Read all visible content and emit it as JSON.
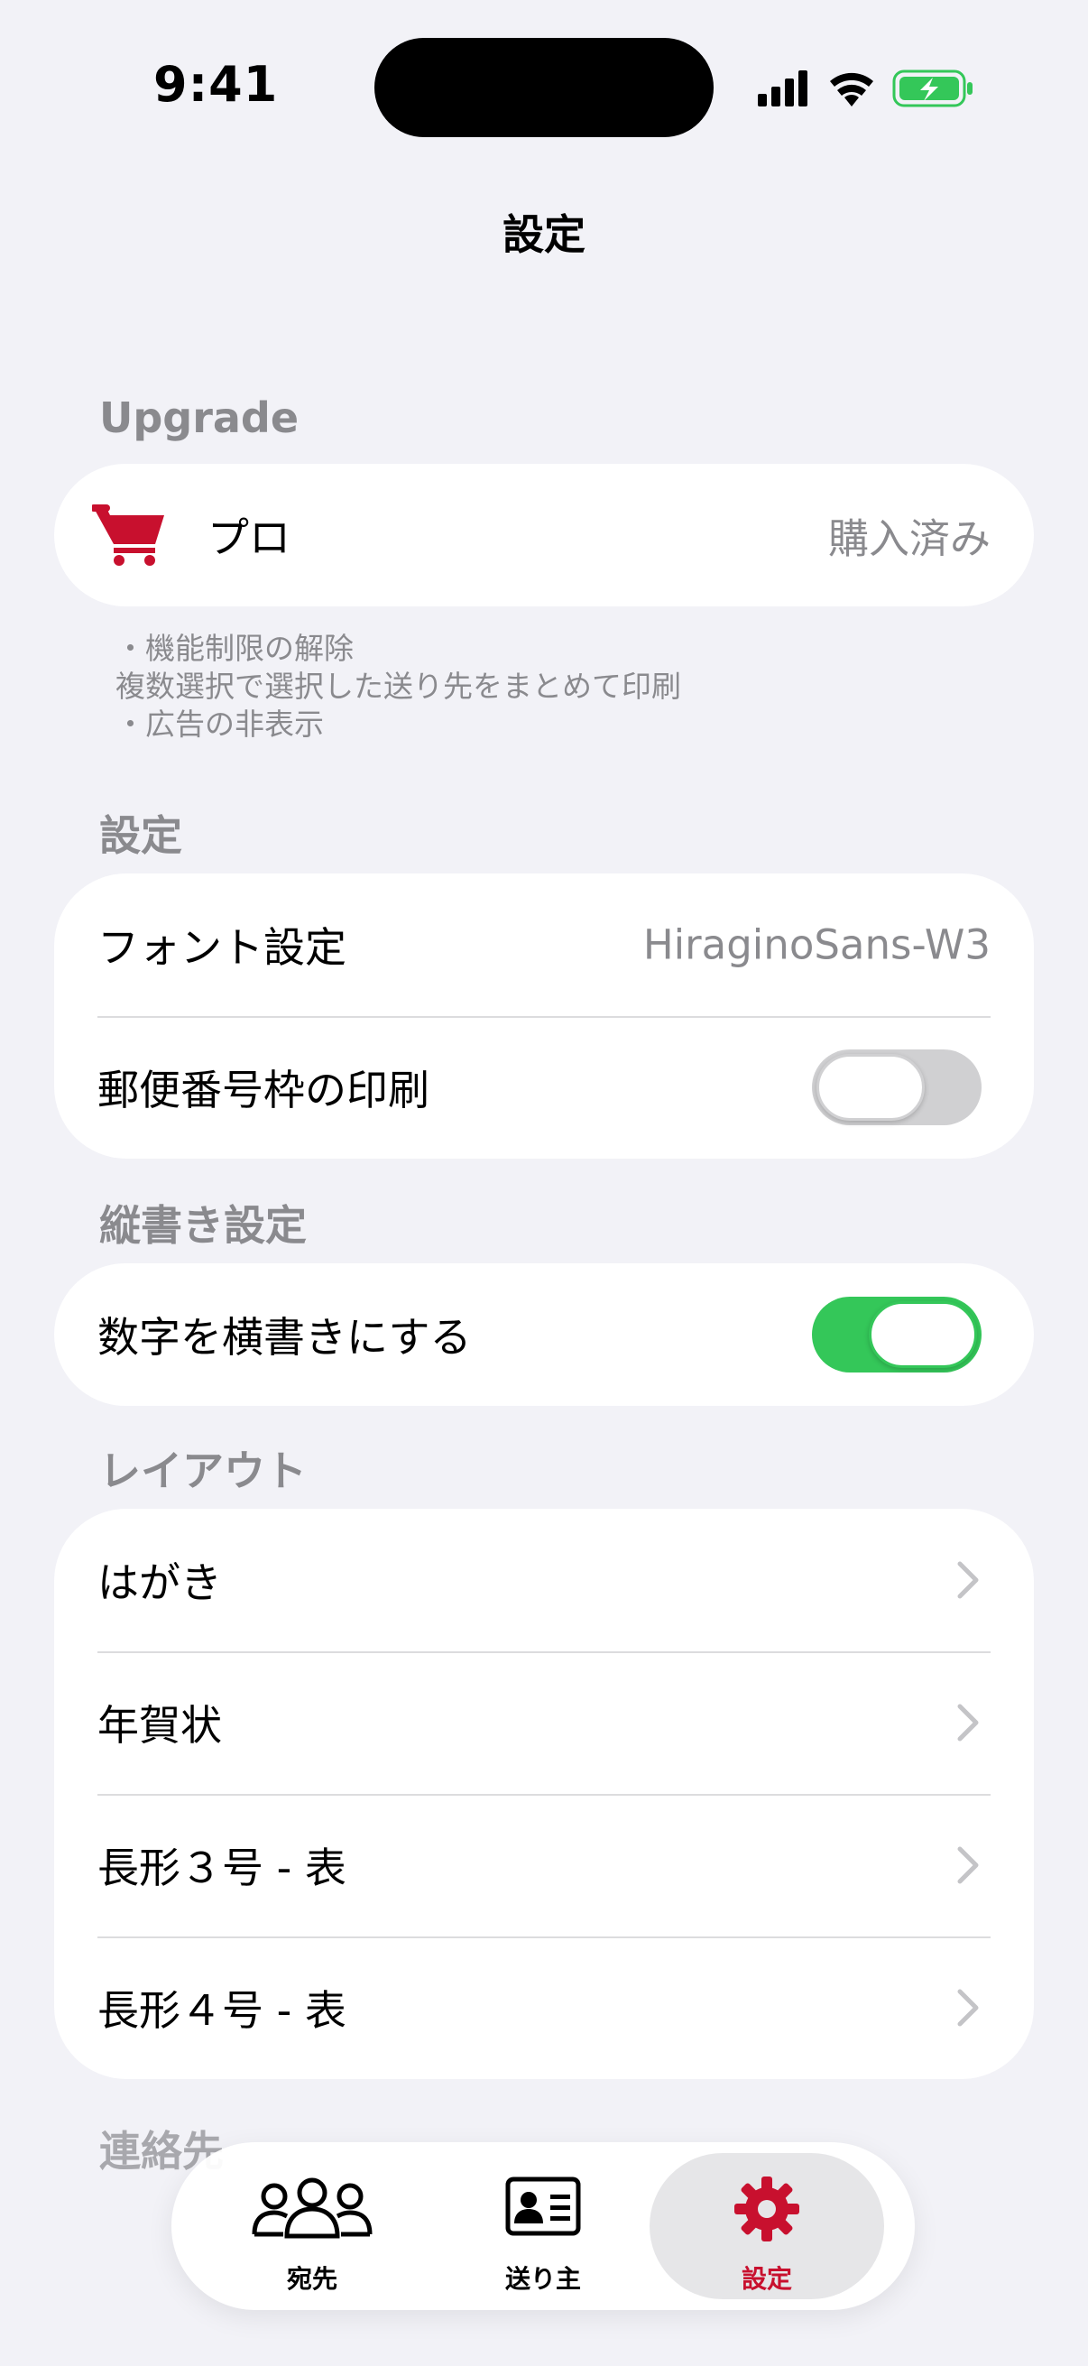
{
  "status_bar": {
    "time": "9:41"
  },
  "nav": {
    "title": "設定"
  },
  "upgrade": {
    "header": "Upgrade",
    "pro_label": "プロ",
    "pro_value": "購入済み",
    "notes": [
      "・機能制限の解除",
      "複数選択で選択した送り先をまとめて印刷",
      "・広告の非表示"
    ]
  },
  "settings": {
    "header": "設定",
    "font_label": "フォント設定",
    "font_value": "HiraginoSans-W3",
    "postal_label": "郵便番号枠の印刷",
    "postal_on": false
  },
  "vertical": {
    "header": "縦書き設定",
    "numbers_label": "数字を横書きにする",
    "numbers_on": true
  },
  "layout": {
    "header": "レイアウト",
    "items": [
      {
        "label": "はがき"
      },
      {
        "label": "年賀状"
      },
      {
        "label": "長形３号 - 表"
      },
      {
        "label": "長形４号 - 表"
      }
    ]
  },
  "next_section": {
    "header": "連絡先"
  },
  "tabs": [
    {
      "label": "宛先",
      "icon": "people-icon"
    },
    {
      "label": "送り主",
      "icon": "contact-card-icon"
    },
    {
      "label": "設定",
      "icon": "gear-icon",
      "selected": true
    }
  ],
  "colors": {
    "accent": "#c8102e",
    "toggle_on": "#34c759",
    "background": "#f2f2f7"
  }
}
